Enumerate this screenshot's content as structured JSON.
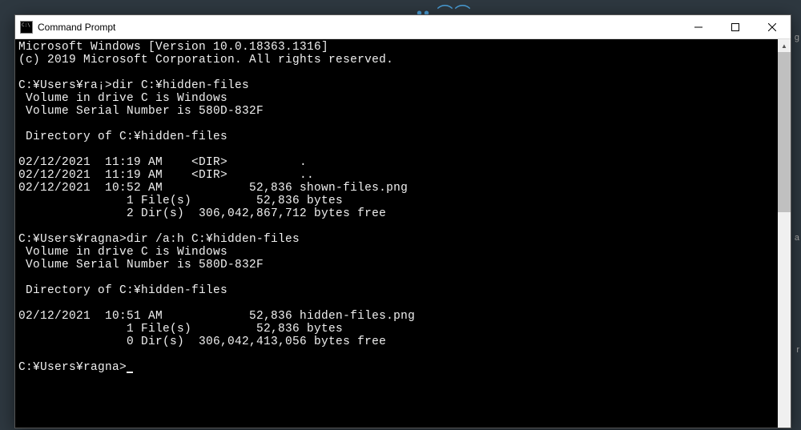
{
  "window": {
    "title": "Command Prompt"
  },
  "terminal": {
    "header1": "Microsoft Windows [Version 10.0.18363.1316]",
    "header2": "(c) 2019 Microsoft Corporation. All rights reserved.",
    "blank1": "",
    "prompt1": "C:¥Users¥ra¡>dir C:¥hidden-files",
    "vol1": " Volume in drive C is Windows",
    "serial1": " Volume Serial Number is 580D-832F",
    "blank2": "",
    "dirof1": " Directory of C:¥hidden-files",
    "blank3": "",
    "row1": "02/12/2021  11:19 AM    <DIR>          .",
    "row2": "02/12/2021  11:19 AM    <DIR>          ..",
    "row3": "02/12/2021  10:52 AM            52,836 shown-files.png",
    "sum1": "               1 File(s)         52,836 bytes",
    "sum2": "               2 Dir(s)  306,042,867,712 bytes free",
    "blank4": "",
    "prompt2": "C:¥Users¥ragna>dir /a:h C:¥hidden-files",
    "vol2": " Volume in drive C is Windows",
    "serial2": " Volume Serial Number is 580D-832F",
    "blank5": "",
    "dirof2": " Directory of C:¥hidden-files",
    "blank6": "",
    "row4": "02/12/2021  10:51 AM            52,836 hidden-files.png",
    "sum3": "               1 File(s)         52,836 bytes",
    "sum4": "               0 Dir(s)  306,042,413,056 bytes free",
    "blank7": "",
    "prompt3": "C:¥Users¥ragna>"
  },
  "side": {
    "t1": "g",
    "t2": "a",
    "t3": "r"
  }
}
